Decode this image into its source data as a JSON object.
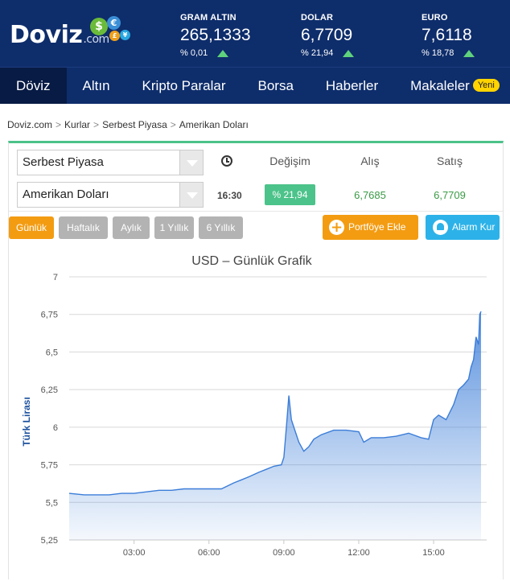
{
  "brand": {
    "logo_main": "Doviz",
    "logo_suffix": ".com",
    "coin_symbols": [
      "$",
      "€",
      "£",
      "¥"
    ]
  },
  "tickers": [
    {
      "name": "GRAM ALTIN",
      "value": "265,1333",
      "change": "% 0,01",
      "trend": "up"
    },
    {
      "name": "DOLAR",
      "value": "6,7709",
      "change": "% 21,94",
      "trend": "up"
    },
    {
      "name": "EURO",
      "value": "7,6118",
      "change": "% 18,78",
      "trend": "up"
    }
  ],
  "nav": {
    "items": [
      "Döviz",
      "Altın",
      "Kripto Paralar",
      "Borsa",
      "Haberler",
      "Makaleler"
    ],
    "active": "Döviz",
    "badge": "Yeni"
  },
  "breadcrumb": [
    "Doviz.com",
    "Kurlar",
    "Serbest Piyasa",
    "Amerikan Doları"
  ],
  "breadcrumb_sep": ">",
  "filters": {
    "market_select": "Serbest Piyasa",
    "currency_select": "Amerikan Doları"
  },
  "rate_table": {
    "headers": {
      "change": "Değişim",
      "buy": "Alış",
      "sell": "Satış"
    },
    "time": "16:30",
    "change": "% 21,94",
    "buy": "6,7685",
    "sell": "6,7709"
  },
  "period_tabs": [
    "Günlük",
    "Haftalık",
    "Aylık",
    "1 Yıllık",
    "6 Yıllık"
  ],
  "active_period": "Günlük",
  "actions": {
    "portfolio": "Portföye Ekle",
    "alarm": "Alarm Kur"
  },
  "colors": {
    "header_bg": "#0e2d6b",
    "accent_green": "#4cc38a",
    "orange": "#f39c12",
    "blue": "#2cb2e8",
    "line": "#3b7dd8"
  },
  "chart_data": {
    "type": "area",
    "title": "USD – Günlük Grafik",
    "xlabel": "",
    "ylabel": "Türk Lirası",
    "x_ticks": [
      "03:00",
      "06:00",
      "09:00",
      "12:00",
      "15:00"
    ],
    "y_ticks": [
      "5,25",
      "5,5",
      "5,75",
      "6",
      "6,25",
      "6,5",
      "6,75",
      "7"
    ],
    "ylim": [
      5.25,
      7
    ],
    "xlim_hours": [
      0.4,
      16.9
    ],
    "grid": true,
    "series": [
      {
        "x": [
          0.4,
          1.0,
          1.5,
          2.0,
          2.5,
          3.0,
          3.5,
          4.0,
          4.5,
          5.0,
          5.5,
          6.0,
          6.5,
          7.0,
          7.3,
          7.6,
          8.0,
          8.3,
          8.6,
          8.9,
          9.0,
          9.1,
          9.2,
          9.3,
          9.4,
          9.6,
          9.8,
          10.0,
          10.2,
          10.5,
          11.0,
          11.5,
          12.0,
          12.2,
          12.5,
          13.0,
          13.5,
          14.0,
          14.5,
          14.8,
          15.0,
          15.2,
          15.5,
          15.8,
          16.0,
          16.2,
          16.4,
          16.5,
          16.6,
          16.7,
          16.8,
          16.85,
          16.9
        ],
        "y": [
          5.56,
          5.55,
          5.55,
          5.55,
          5.56,
          5.56,
          5.57,
          5.58,
          5.58,
          5.59,
          5.59,
          5.59,
          5.59,
          5.63,
          5.65,
          5.67,
          5.7,
          5.72,
          5.74,
          5.75,
          5.8,
          6.0,
          6.21,
          6.05,
          6.0,
          5.9,
          5.84,
          5.87,
          5.92,
          5.95,
          5.98,
          5.98,
          5.97,
          5.9,
          5.93,
          5.93,
          5.94,
          5.96,
          5.93,
          5.92,
          6.05,
          6.08,
          6.05,
          6.15,
          6.25,
          6.28,
          6.32,
          6.4,
          6.45,
          6.6,
          6.55,
          6.75,
          6.77
        ]
      }
    ]
  }
}
